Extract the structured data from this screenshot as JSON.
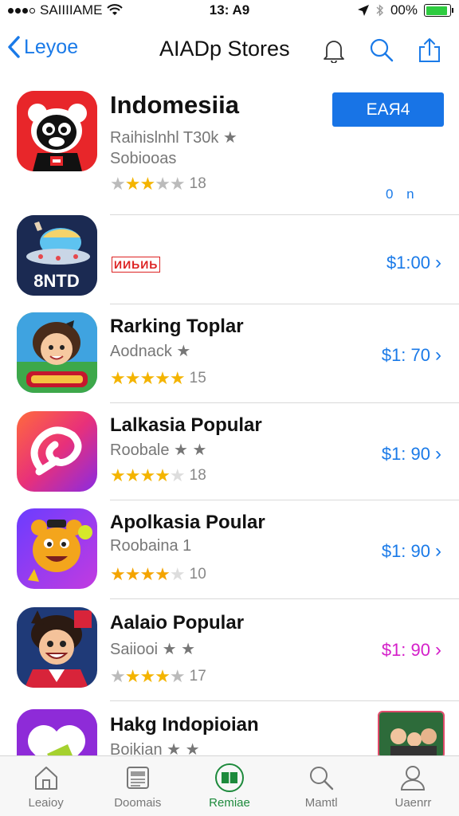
{
  "status_bar": {
    "carrier": "SAIIIIAME",
    "time": "13: A9",
    "battery": "00%",
    "battery_level": 0.9
  },
  "nav": {
    "back_label": "Leyoe",
    "title": "AIADp Stores"
  },
  "featured": {
    "name": "Indomesiia",
    "subtitle": "Raihislnhl T30k ★",
    "developer": "Sobiooas",
    "stars": "★★★★★",
    "rating_count": "18",
    "get_label": "EAЯ4",
    "get_sub": "0 n"
  },
  "apps": [
    {
      "name": "",
      "badge": "ИИЬИЬ",
      "subtitle": "",
      "stars": "",
      "rating_count": "",
      "price": "$1:00"
    },
    {
      "name": "Rarking Toplar",
      "subtitle": "Aodnack ★",
      "stars": "★★★★★",
      "rating_count": "15",
      "price": "$1: 70"
    },
    {
      "name": "Lalkasia Popular",
      "subtitle": "Roobale ★ ★",
      "stars": "★★★★★",
      "rating_count": "18",
      "price": "$1: 90"
    },
    {
      "name": "Apolkasia Poular",
      "subtitle": "Roobaina 1",
      "stars": "★★★★★",
      "rating_count": "10",
      "price": "$1: 90"
    },
    {
      "name": "Aalaio Popular",
      "subtitle": "Saiiooi ★ ★",
      "stars": "★★★★★",
      "rating_count": "17",
      "price": "$1: 90"
    },
    {
      "name": "Hakg Indopioian",
      "subtitle": "Boikian ★ ★",
      "stars": "",
      "rating_count": "",
      "price": ""
    }
  ],
  "app_icon_text": {
    "sntd": "8NTD"
  },
  "tabs": [
    {
      "label": "Leaioy",
      "icon": "home-icon"
    },
    {
      "label": "Doomais",
      "icon": "newspaper-icon"
    },
    {
      "label": "Remiae",
      "icon": "featured-icon"
    },
    {
      "label": "Mamtl",
      "icon": "search-icon"
    },
    {
      "label": "Uaenrr",
      "icon": "person-icon"
    }
  ],
  "colors": {
    "accent": "#1a7ae8",
    "get_button": "#1874e6",
    "magenta_price": "#d41fc9",
    "active_tab": "#1d8a3c",
    "star_gold": "#f4b400"
  }
}
